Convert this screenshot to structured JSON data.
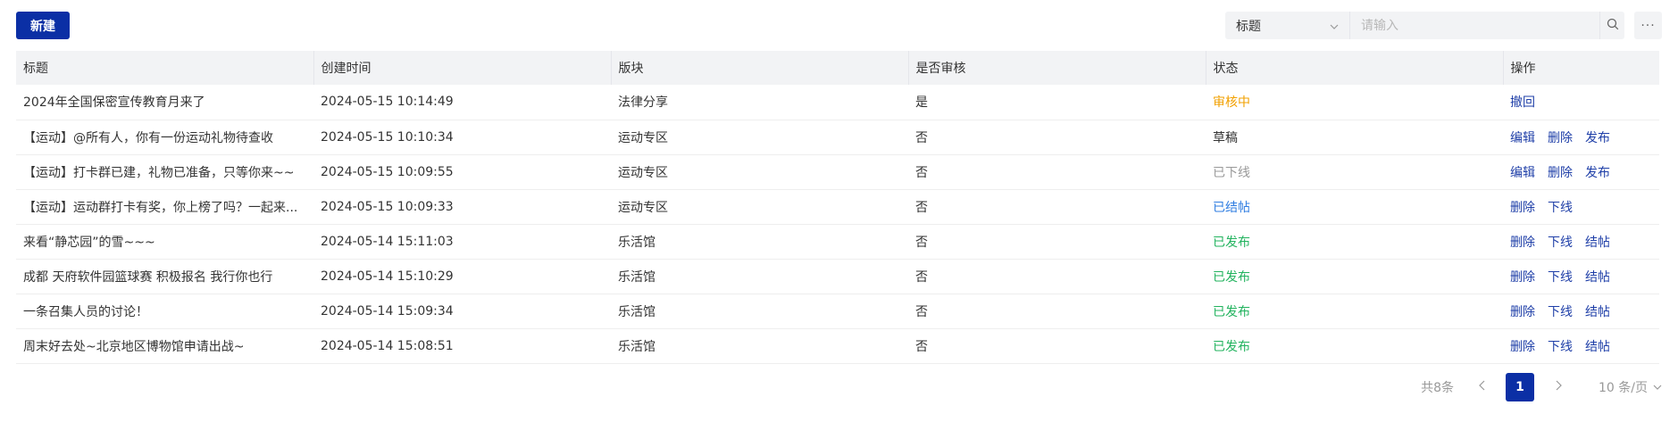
{
  "toolbar": {
    "new_label": "新建",
    "filter_field": "标题",
    "search_placeholder": "请输入",
    "more": "···"
  },
  "table": {
    "headers": [
      "标题",
      "创建时间",
      "版块",
      "是否审核",
      "状态",
      "操作"
    ],
    "rows": [
      {
        "title": "2024年全国保密宣传教育月来了",
        "time": "2024-05-15 10:14:49",
        "section": "法律分享",
        "reviewed": "是",
        "status": "审核中",
        "status_class": "status-reviewing",
        "actions": [
          "撤回"
        ]
      },
      {
        "title": "【运动】@所有人，你有一份运动礼物待查收",
        "time": "2024-05-15 10:10:34",
        "section": "运动专区",
        "reviewed": "否",
        "status": "草稿",
        "status_class": "status-draft",
        "actions": [
          "编辑",
          "删除",
          "发布"
        ]
      },
      {
        "title": "【运动】打卡群已建，礼物已准备，只等你来~~",
        "time": "2024-05-15 10:09:55",
        "section": "运动专区",
        "reviewed": "否",
        "status": "已下线",
        "status_class": "status-offline",
        "actions": [
          "编辑",
          "删除",
          "发布"
        ]
      },
      {
        "title": "【运动】运动群打卡有奖，你上榜了吗？一起来...",
        "time": "2024-05-15 10:09:33",
        "section": "运动专区",
        "reviewed": "否",
        "status": "已结帖",
        "status_class": "status-closed",
        "actions": [
          "删除",
          "下线"
        ]
      },
      {
        "title": "来看“静芯园”的雪~~~",
        "time": "2024-05-14 15:11:03",
        "section": "乐活馆",
        "reviewed": "否",
        "status": "已发布",
        "status_class": "status-published",
        "actions": [
          "删除",
          "下线",
          "结帖"
        ]
      },
      {
        "title": "成都 天府软件园篮球赛 积极报名 我行你也行",
        "time": "2024-05-14 15:10:29",
        "section": "乐活馆",
        "reviewed": "否",
        "status": "已发布",
        "status_class": "status-published",
        "actions": [
          "删除",
          "下线",
          "结帖"
        ]
      },
      {
        "title": "一条召集人员的讨论！",
        "time": "2024-05-14 15:09:34",
        "section": "乐活馆",
        "reviewed": "否",
        "status": "已发布",
        "status_class": "status-published",
        "actions": [
          "删除",
          "下线",
          "结帖"
        ]
      },
      {
        "title": "周末好去处~北京地区博物馆申请出战~",
        "time": "2024-05-14 15:08:51",
        "section": "乐活馆",
        "reviewed": "否",
        "status": "已发布",
        "status_class": "status-published",
        "actions": [
          "删除",
          "下线",
          "结帖"
        ]
      }
    ]
  },
  "pagination": {
    "total": "共8条",
    "current_page": "1",
    "page_size": "10 条/页"
  }
}
